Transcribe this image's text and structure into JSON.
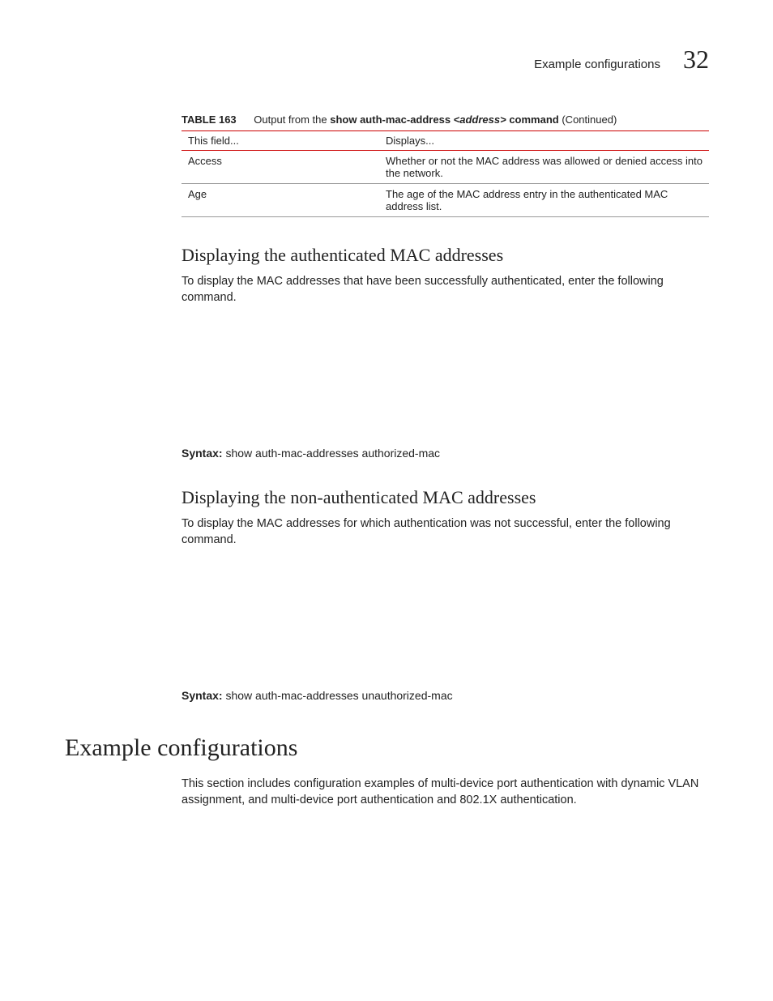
{
  "header": {
    "section_label": "Example configurations",
    "chapter_number": "32"
  },
  "table": {
    "label": "TABLE 163",
    "caption_prefix": "Output from the ",
    "caption_cmd_bold": "show auth-mac-address ",
    "caption_cmd_arg": "<address>",
    "caption_cmd_suffix": " command",
    "caption_continued": "  (Continued)",
    "columns": [
      "This field...",
      "Displays..."
    ],
    "rows": [
      {
        "field": "Access",
        "desc": "Whether or not the MAC address was allowed or denied access into the network."
      },
      {
        "field": "Age",
        "desc": "The age of the MAC address entry in the authenticated MAC address list."
      }
    ]
  },
  "sec1": {
    "heading": "Displaying the authenticated MAC addresses",
    "body": "To display the MAC addresses that have been successfully authenticated, enter the following command.",
    "syntax_label": "Syntax:",
    "syntax_text": " show auth-mac-addresses authorized-mac"
  },
  "sec2": {
    "heading": "Displaying the non-authenticated MAC addresses",
    "body": "To display the MAC addresses for which authentication was not successful, enter the following command.",
    "syntax_label": "Syntax:",
    "syntax_text": " show auth-mac-addresses unauthorized-mac"
  },
  "main_section": {
    "heading": "Example configurations",
    "body": "This section includes configuration examples of multi-device port authentication with dynamic VLAN assignment, and multi-device port authentication and 802.1X authentication."
  }
}
